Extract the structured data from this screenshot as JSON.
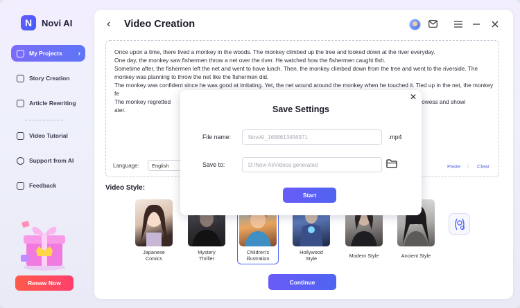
{
  "app": {
    "name": "Novi AI",
    "logo_letter": "N",
    "brand_color": "#5d6cf6"
  },
  "sidebar": {
    "items": [
      {
        "label": "My Projects",
        "icon": "folder-icon",
        "active": true
      },
      {
        "label": "Story Creation",
        "icon": "book-icon"
      },
      {
        "label": "Article Rewriting",
        "icon": "edit-icon"
      },
      {
        "label": "Video Tutorial",
        "icon": "video-icon"
      },
      {
        "label": "Support from AI",
        "icon": "headset-icon"
      },
      {
        "label": "Feedback",
        "icon": "chat-icon"
      }
    ],
    "renew_label": "Renew Now"
  },
  "header": {
    "title": "Video Creation"
  },
  "editor": {
    "story_lines": [
      "Once upon a time, there lived a monkey in the woods. The monkey climbed up the tree and looked down at the river everyday.",
      "One day, the monkey saw fishermen throw a net over the river. He watched how the fishermen caught fish.",
      "Sometime after, the fishermen left the net and went to have lunch. Then, the monkey climbed down from the tree and went to the riverside. The monkey was planning to throw the net like the fishermen did.",
      "The monkey was confident since he was good at imitating. Yet, the net wound around the monkey when he touched it. Tied up in the net, the monkey fe",
      "The monkey regretted                                                                                                             uching it. After believing my prowess and showi                                                                                                             ater."
    ],
    "language_label": "Language:",
    "language_value": "English",
    "paste_label": "Paste",
    "clear_label": "Clear"
  },
  "video_style": {
    "title": "Video Style:",
    "styles": [
      {
        "label": "Japanese Comics",
        "l1": "Japanese",
        "l2": "Comics"
      },
      {
        "label": "Mystery Thriller",
        "l1": "Mystery",
        "l2": "Thriller"
      },
      {
        "label": "Children's illustration",
        "l1": "Children's",
        "l2": "illustration",
        "selected": true
      },
      {
        "label": "Hollywood Style",
        "l1": "Hollywood",
        "l2": "Style"
      },
      {
        "label": "Modern Style",
        "l1": "Modern Style",
        "l2": ""
      },
      {
        "label": "Ancient Style",
        "l1": "Ancient Style",
        "l2": ""
      }
    ],
    "continue_label": "Continue"
  },
  "modal": {
    "title": "Save Settings",
    "file_name_label": "File name:",
    "file_name_value": "NoviAI_1688613456971",
    "extension": ".mp4",
    "save_to_label": "Save to:",
    "save_to_value": "D:/Novi AI/Videos generated",
    "start_label": "Start"
  }
}
